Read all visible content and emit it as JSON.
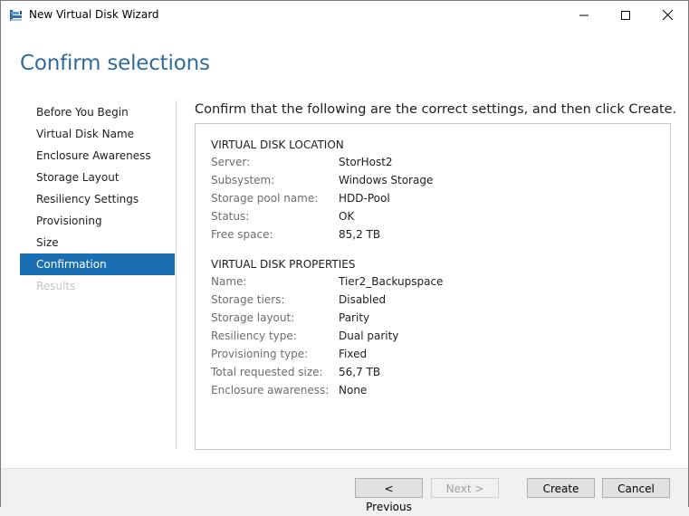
{
  "window": {
    "title": "New Virtual Disk Wizard",
    "controls": {
      "minimize": "minimize",
      "maximize": "maximize",
      "close": "close"
    }
  },
  "header": {
    "title": "Confirm selections"
  },
  "nav": {
    "items": [
      {
        "label": "Before You Begin",
        "state": "normal"
      },
      {
        "label": "Virtual Disk Name",
        "state": "normal"
      },
      {
        "label": "Enclosure Awareness",
        "state": "normal"
      },
      {
        "label": "Storage Layout",
        "state": "normal"
      },
      {
        "label": "Resiliency Settings",
        "state": "normal"
      },
      {
        "label": "Provisioning",
        "state": "normal"
      },
      {
        "label": "Size",
        "state": "normal"
      },
      {
        "label": "Confirmation",
        "state": "active"
      },
      {
        "label": "Results",
        "state": "disabled"
      }
    ]
  },
  "main": {
    "intro": "Confirm that the following are the correct settings, and then click Create.",
    "sections": [
      {
        "title": "VIRTUAL DISK LOCATION",
        "rows": [
          {
            "key": "Server:",
            "value": "StorHost2"
          },
          {
            "key": "Subsystem:",
            "value": "Windows Storage"
          },
          {
            "key": "Storage pool name:",
            "value": "HDD-Pool"
          },
          {
            "key": "Status:",
            "value": "OK"
          },
          {
            "key": "Free space:",
            "value": "85,2 TB"
          }
        ]
      },
      {
        "title": "VIRTUAL DISK PROPERTIES",
        "rows": [
          {
            "key": "Name:",
            "value": "Tier2_Backupspace"
          },
          {
            "key": "Storage tiers:",
            "value": "Disabled"
          },
          {
            "key": "Storage layout:",
            "value": "Parity"
          },
          {
            "key": "Resiliency type:",
            "value": "Dual parity"
          },
          {
            "key": "Provisioning type:",
            "value": "Fixed"
          },
          {
            "key": "Total requested size:",
            "value": "56,7 TB"
          },
          {
            "key": "Enclosure awareness:",
            "value": "None"
          }
        ]
      }
    ]
  },
  "footer": {
    "previous": "< Previous",
    "next": "Next >",
    "create": "Create",
    "cancel": "Cancel"
  },
  "colors": {
    "accent": "#1a6fb3",
    "title": "#2f6c9a",
    "disabled_text": "#c4c4c4"
  }
}
